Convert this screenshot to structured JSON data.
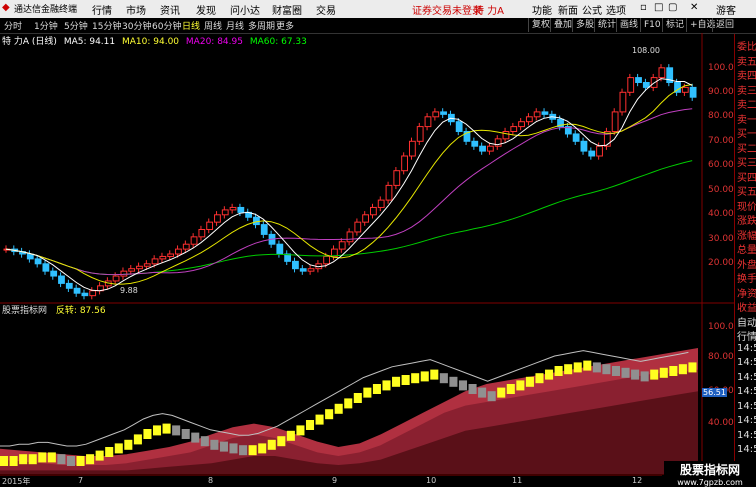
{
  "menubar": {
    "app_title": "通达信金融终端",
    "items": [
      "行情",
      "市场",
      "资讯",
      "发现",
      "问小达",
      "财富圈",
      "交易"
    ],
    "notice": "证券交易未登录",
    "stock_name": "特 力A",
    "right_items": [
      "功能",
      "新面",
      "公式",
      "选项"
    ],
    "guest": "游客"
  },
  "toolbar": {
    "periods": [
      "分时",
      "1分钟",
      "5分钟",
      "15分钟",
      "30分钟",
      "60分钟",
      "日线",
      "周线",
      "月线",
      "多周期",
      "更多"
    ],
    "active_period": "日线",
    "right_buttons": [
      "复权",
      "叠加",
      "多股",
      "统计",
      "画线",
      "F10",
      "标记",
      "+自选",
      "返回"
    ]
  },
  "legend": {
    "name": "特 力A",
    "period": "(日线)",
    "ma5": "MA5: 94.11",
    "ma10": "MA10: 94.00",
    "ma20": "MA20: 84.95",
    "ma60": "MA60: 67.33"
  },
  "price_axis": [
    "100.0",
    "90.00",
    "80.00",
    "70.00",
    "60.00",
    "50.00",
    "40.00",
    "30.00",
    "20.00"
  ],
  "annotations": {
    "high": "108.00",
    "low": "9.88"
  },
  "indicator": {
    "title": "股票指标网",
    "label": "反转:",
    "value": "87.56",
    "axis": [
      "100.0",
      "80.00",
      "60.00",
      "40.00"
    ],
    "marker": "56.51"
  },
  "sidepanel": [
    "委比",
    "卖五",
    "卖四",
    "卖三",
    "卖二",
    "卖一",
    "买一",
    "买二",
    "买三",
    "买四",
    "买五",
    "现价",
    "涨跌",
    "涨幅",
    "总量",
    "外盘",
    "换手",
    "净资",
    "收益",
    "自动",
    "行情",
    "14:5",
    "14:5",
    "14:5",
    "14:5",
    "14:5",
    "14:5",
    "14:5",
    "14:5"
  ],
  "bottom_dates": [
    "2015年",
    "7",
    "8",
    "9",
    "10",
    "11",
    "12"
  ],
  "watermark": {
    "text": "股票指标网",
    "url": "www.7gpzb.com"
  },
  "colors": {
    "up": "#ff3030",
    "down": "#30c0ff",
    "ma5": "#ffffff",
    "ma10": "#ffff00",
    "ma20": "#ff40ff",
    "ma60": "#00ff00",
    "yellow_bar": "#ffff20",
    "purple": "#6040ff"
  }
}
